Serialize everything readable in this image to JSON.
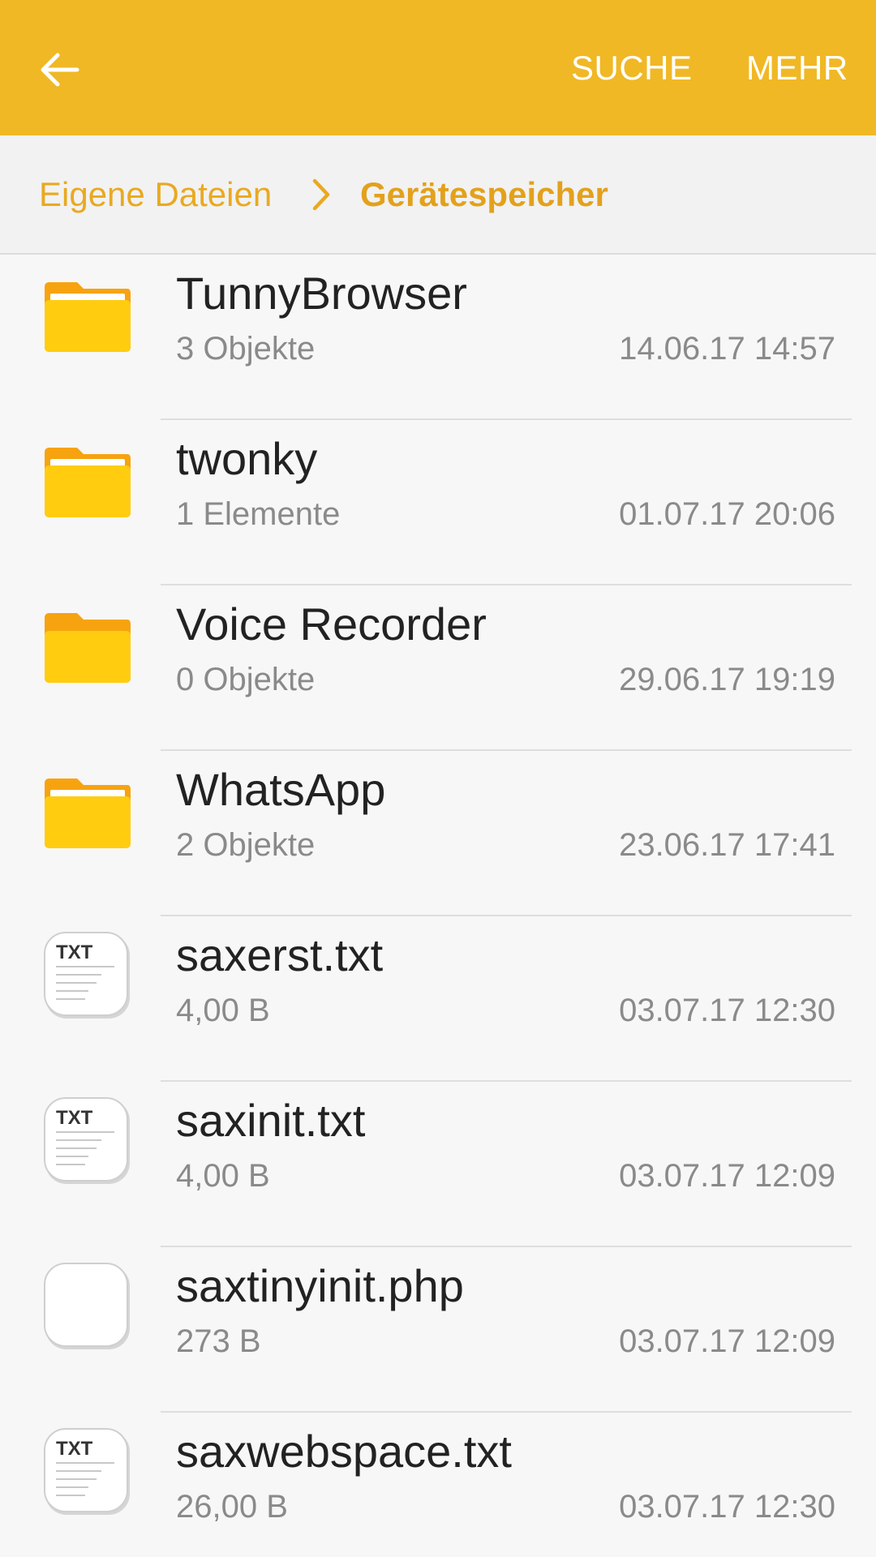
{
  "header": {
    "back_icon": "arrow-left-icon",
    "search_label": "SUCHE",
    "more_label": "MEHR",
    "color": "#f0b825"
  },
  "breadcrumb": {
    "root": "Eigene Dateien",
    "separator_icon": "chevron-right-icon",
    "current": "Gerätespeicher",
    "accent_color": "#e9a920"
  },
  "files": [
    {
      "name": "TunnyBrowser",
      "info": "3 Objekte",
      "date": "14.06.17 14:57",
      "icon": "folder-icon"
    },
    {
      "name": "twonky",
      "info": "1 Elemente",
      "date": "01.07.17 20:06",
      "icon": "folder-icon"
    },
    {
      "name": "Voice Recorder",
      "info": "0 Objekte",
      "date": "29.06.17 19:19",
      "icon": "empty-folder-icon"
    },
    {
      "name": "WhatsApp",
      "info": "2 Objekte",
      "date": "23.06.17 17:41",
      "icon": "folder-icon"
    },
    {
      "name": "saxerst.txt",
      "info": "4,00 B",
      "date": "03.07.17 12:30",
      "icon": "txt-file-icon",
      "icon_label": "TXT"
    },
    {
      "name": "saxinit.txt",
      "info": "4,00 B",
      "date": "03.07.17 12:09",
      "icon": "txt-file-icon",
      "icon_label": "TXT"
    },
    {
      "name": "saxtinyinit.php",
      "info": "273 B",
      "date": "03.07.17 12:09",
      "icon": "generic-file-icon"
    },
    {
      "name": "saxwebspace.txt",
      "info": "26,00 B",
      "date": "03.07.17 12:30",
      "icon": "txt-file-icon",
      "icon_label": "TXT"
    }
  ]
}
